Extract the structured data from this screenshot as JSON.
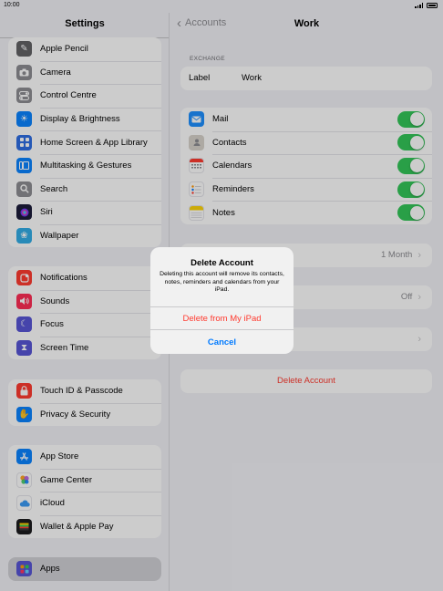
{
  "status_bar": {
    "time": "10:00"
  },
  "sidebar": {
    "title": "Settings",
    "group1": [
      {
        "label": "Apple Pencil",
        "icon": "pencil-icon",
        "color": "#636366"
      },
      {
        "label": "Camera",
        "icon": "camera-icon",
        "color": "#8e8e93"
      },
      {
        "label": "Control Centre",
        "icon": "toggles-icon",
        "color": "#8e8e93"
      },
      {
        "label": "Display & Brightness",
        "icon": "sun-icon",
        "color": "#0a84ff"
      },
      {
        "label": "Home Screen & App Library",
        "icon": "grid-icon",
        "color": "#2f6fe4"
      },
      {
        "label": "Multitasking & Gestures",
        "icon": "multitask-icon",
        "color": "#0a84ff"
      },
      {
        "label": "Search",
        "icon": "search-icon",
        "color": "#8e8e93"
      },
      {
        "label": "Siri",
        "icon": "siri-icon",
        "color": "#1c1c3a"
      },
      {
        "label": "Wallpaper",
        "icon": "flower-icon",
        "color": "#32ade6"
      }
    ],
    "group2": [
      {
        "label": "Notifications",
        "icon": "bell-icon",
        "color": "#ff3b30"
      },
      {
        "label": "Sounds",
        "icon": "speaker-icon",
        "color": "#ff2d55"
      },
      {
        "label": "Focus",
        "icon": "moon-icon",
        "color": "#5856d6"
      },
      {
        "label": "Screen Time",
        "icon": "hourglass-icon",
        "color": "#5856d6"
      }
    ],
    "group3": [
      {
        "label": "Touch ID & Passcode",
        "icon": "lock-icon",
        "color": "#ff3b30"
      },
      {
        "label": "Privacy & Security",
        "icon": "hand-icon",
        "color": "#0a84ff"
      }
    ],
    "group4": [
      {
        "label": "App Store",
        "icon": "app-store-icon",
        "color": "#0a84ff"
      },
      {
        "label": "Game Center",
        "icon": "game-center-icon",
        "color": "#e5e5ea"
      },
      {
        "label": "iCloud",
        "icon": "cloud-icon",
        "color": "#e5e5ea"
      },
      {
        "label": "Wallet & Apple Pay",
        "icon": "wallet-icon",
        "color": "#1c1c1e"
      }
    ],
    "group5": [
      {
        "label": "Apps",
        "icon": "apps-grid-icon",
        "color": "#5856d6"
      }
    ]
  },
  "detail": {
    "back_label": "Accounts",
    "title": "Work",
    "section_header": "EXCHANGE",
    "label_field": {
      "key": "Label",
      "value": "Work"
    },
    "services": [
      {
        "label": "Mail",
        "icon": "mail-icon",
        "color": "#1e90ff",
        "on": true
      },
      {
        "label": "Contacts",
        "icon": "contacts-icon",
        "color": "#b0a89c",
        "on": true
      },
      {
        "label": "Calendars",
        "icon": "calendar-icon",
        "color": "#ffffff",
        "on": true
      },
      {
        "label": "Reminders",
        "icon": "reminders-icon",
        "color": "#ffffff",
        "on": true
      },
      {
        "label": "Notes",
        "icon": "notes-icon",
        "color": "#ffd60a",
        "on": true
      }
    ],
    "mail_days_value": "1 Month",
    "auto_reply_value": "Off",
    "delete_account_label": "Delete Account"
  },
  "alert": {
    "title": "Delete Account",
    "message": "Deleting this account will remove its contacts, notes, reminders and calendars from your iPad.",
    "destructive_label": "Delete from My iPad",
    "cancel_label": "Cancel"
  },
  "colors": {
    "accent": "#007aff",
    "destructive": "#ff3b30",
    "toggle_on": "#34c759"
  }
}
